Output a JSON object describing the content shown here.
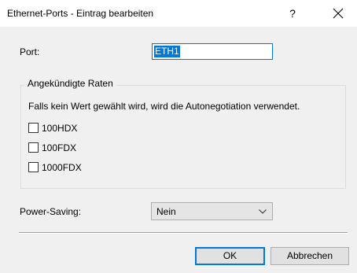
{
  "window": {
    "title": "Ethernet-Ports - Eintrag bearbeiten",
    "help_label": "?",
    "close_icon": "close-icon"
  },
  "form": {
    "port_label": "Port:",
    "port_value": "ETH1",
    "group": {
      "title": "Angekündigte Raten",
      "hint": "Falls kein Wert gewählt wird, wird die Autonegotiation verwendet.",
      "options": [
        {
          "label": "100HDX",
          "checked": false
        },
        {
          "label": "100FDX",
          "checked": false
        },
        {
          "label": "1000FDX",
          "checked": false
        }
      ]
    },
    "power_saving_label": "Power-Saving:",
    "power_saving_value": "Nein"
  },
  "buttons": {
    "ok": "OK",
    "cancel": "Abbrechen"
  },
  "colors": {
    "accent": "#0078d7",
    "background": "#f0f0f0"
  }
}
